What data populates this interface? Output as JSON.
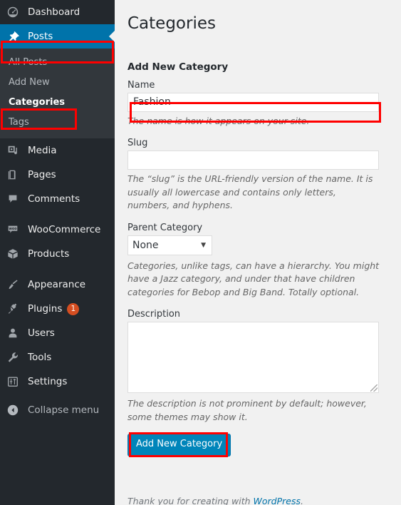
{
  "colors": {
    "sidebar_bg": "#23282d",
    "submenu_bg": "#32373c",
    "active_blue": "#0073aa",
    "button_blue": "#0085ba",
    "badge_orange": "#d54e21",
    "highlight_red": "#ff0000",
    "content_bg": "#f1f1f1",
    "link_blue": "#0073aa"
  },
  "sidebar": {
    "items": [
      {
        "label": "Dashboard",
        "icon": "dashboard-gauge-icon",
        "current": false
      },
      {
        "label": "Posts",
        "icon": "pin-icon",
        "current": true
      }
    ],
    "submenu": [
      {
        "label": "All Posts",
        "active": false
      },
      {
        "label": "Add New",
        "active": false
      },
      {
        "label": "Categories",
        "active": true
      },
      {
        "label": "Tags",
        "active": false
      }
    ],
    "items2": [
      {
        "label": "Media",
        "icon": "media-icon"
      },
      {
        "label": "Pages",
        "icon": "pages-icon"
      },
      {
        "label": "Comments",
        "icon": "comment-bubble-icon"
      }
    ],
    "items3": [
      {
        "label": "WooCommerce",
        "icon": "woocommerce-icon"
      },
      {
        "label": "Products",
        "icon": "box-icon"
      }
    ],
    "items4": [
      {
        "label": "Appearance",
        "icon": "paintbrush-icon",
        "badge": ""
      },
      {
        "label": "Plugins",
        "icon": "plug-icon",
        "badge": "1"
      },
      {
        "label": "Users",
        "icon": "user-icon",
        "badge": ""
      },
      {
        "label": "Tools",
        "icon": "wrench-icon",
        "badge": ""
      },
      {
        "label": "Settings",
        "icon": "sliders-icon",
        "badge": ""
      }
    ],
    "collapse": {
      "label": "Collapse menu",
      "icon": "collapse-left-arrow-icon"
    }
  },
  "main": {
    "page_title": "Categories",
    "section_heading": "Add New Category",
    "name": {
      "label": "Name",
      "value": "Fashion",
      "placeholder": "",
      "help": "The name is how it appears on your site."
    },
    "slug": {
      "label": "Slug",
      "value": "",
      "placeholder": "",
      "help": "The “slug” is the URL-friendly version of the name. It is usually all lowercase and contains only letters, numbers, and hyphens."
    },
    "parent": {
      "label": "Parent Category",
      "selected": "None",
      "options": [
        "None"
      ],
      "help": "Categories, unlike tags, can have a hierarchy. You might have a Jazz category, and under that have children categories for Bebop and Big Band. Totally optional."
    },
    "description": {
      "label": "Description",
      "value": "",
      "help": "The description is not prominent by default; however, some themes may show it."
    },
    "submit_label": "Add New Category"
  },
  "footer": {
    "text_before": "Thank you for creating with ",
    "link": "WordPress",
    "text_after": "."
  }
}
